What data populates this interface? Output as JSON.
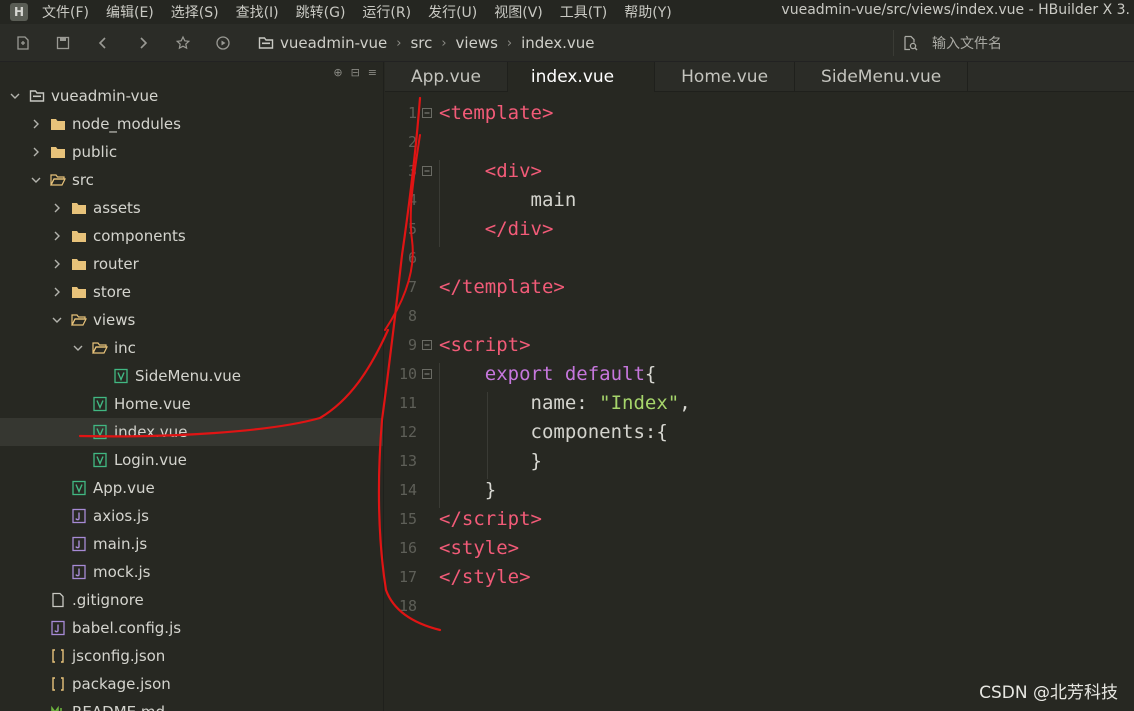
{
  "menu": {
    "items": [
      "文件(F)",
      "编辑(E)",
      "选择(S)",
      "查找(I)",
      "跳转(G)",
      "运行(R)",
      "发行(U)",
      "视图(V)",
      "工具(T)",
      "帮助(Y)"
    ],
    "window_title": "vueadmin-vue/src/views/index.vue - HBuilder X 3.",
    "logo_letter": "H"
  },
  "toolbar": {
    "breadcrumb": [
      "vueadmin-vue",
      "src",
      "views",
      "index.vue"
    ],
    "search_placeholder": "输入文件名"
  },
  "sidebar": {
    "tree": [
      {
        "label": "vueadmin-vue",
        "depth": 0,
        "kind": "project",
        "expanded": true
      },
      {
        "label": "node_modules",
        "depth": 1,
        "kind": "folder",
        "expanded": false
      },
      {
        "label": "public",
        "depth": 1,
        "kind": "folder",
        "expanded": false
      },
      {
        "label": "src",
        "depth": 1,
        "kind": "folder-open",
        "expanded": true
      },
      {
        "label": "assets",
        "depth": 2,
        "kind": "folder",
        "expanded": false
      },
      {
        "label": "components",
        "depth": 2,
        "kind": "folder",
        "expanded": false
      },
      {
        "label": "router",
        "depth": 2,
        "kind": "folder",
        "expanded": false
      },
      {
        "label": "store",
        "depth": 2,
        "kind": "folder",
        "expanded": false
      },
      {
        "label": "views",
        "depth": 2,
        "kind": "folder-open",
        "expanded": true
      },
      {
        "label": "inc",
        "depth": 3,
        "kind": "folder-open",
        "expanded": true
      },
      {
        "label": "SideMenu.vue",
        "depth": 4,
        "kind": "vue"
      },
      {
        "label": "Home.vue",
        "depth": 3,
        "kind": "vue"
      },
      {
        "label": "index.vue",
        "depth": 3,
        "kind": "vue",
        "selected": true
      },
      {
        "label": "Login.vue",
        "depth": 3,
        "kind": "vue"
      },
      {
        "label": "App.vue",
        "depth": 2,
        "kind": "vue"
      },
      {
        "label": "axios.js",
        "depth": 2,
        "kind": "js"
      },
      {
        "label": "main.js",
        "depth": 2,
        "kind": "js"
      },
      {
        "label": "mock.js",
        "depth": 2,
        "kind": "js"
      },
      {
        "label": ".gitignore",
        "depth": 1,
        "kind": "file"
      },
      {
        "label": "babel.config.js",
        "depth": 1,
        "kind": "js"
      },
      {
        "label": "jsconfig.json",
        "depth": 1,
        "kind": "json"
      },
      {
        "label": "package.json",
        "depth": 1,
        "kind": "json"
      },
      {
        "label": "README.md",
        "depth": 1,
        "kind": "md"
      }
    ]
  },
  "editor": {
    "tabs": [
      {
        "label": "App.vue",
        "active": false
      },
      {
        "label": "index.vue",
        "active": true
      },
      {
        "label": "Home.vue",
        "active": false
      },
      {
        "label": "SideMenu.vue",
        "active": false
      }
    ],
    "lines": [
      {
        "n": "1",
        "fold": true,
        "tokens": [
          [
            "tag",
            "<template"
          ],
          [
            "tag",
            ">"
          ]
        ]
      },
      {
        "n": "2",
        "fold": false,
        "tokens": []
      },
      {
        "n": "3",
        "fold": true,
        "tokens": [
          [
            "plain",
            "    "
          ],
          [
            "tag",
            "<div"
          ],
          [
            "tag",
            ">"
          ]
        ]
      },
      {
        "n": "4",
        "fold": false,
        "tokens": [
          [
            "plain",
            "        main"
          ]
        ]
      },
      {
        "n": "5",
        "fold": false,
        "tokens": [
          [
            "plain",
            "    "
          ],
          [
            "tag",
            "</div"
          ],
          [
            "tag",
            ">"
          ]
        ]
      },
      {
        "n": "6",
        "fold": false,
        "tokens": []
      },
      {
        "n": "7",
        "fold": false,
        "tokens": [
          [
            "tag",
            "</template"
          ],
          [
            "tag",
            ">"
          ]
        ]
      },
      {
        "n": "8",
        "fold": false,
        "tokens": []
      },
      {
        "n": "9",
        "fold": true,
        "tokens": [
          [
            "tag",
            "<script"
          ],
          [
            "tag",
            ">"
          ]
        ]
      },
      {
        "n": "10",
        "fold": true,
        "tokens": [
          [
            "plain",
            "    "
          ],
          [
            "kw",
            "export default"
          ],
          [
            "punc",
            "{"
          ]
        ]
      },
      {
        "n": "11",
        "fold": false,
        "tokens": [
          [
            "plain",
            "        name: "
          ],
          [
            "str",
            "\"Index\""
          ],
          [
            "punc",
            ","
          ]
        ]
      },
      {
        "n": "12",
        "fold": false,
        "tokens": [
          [
            "plain",
            "        components:"
          ],
          [
            "punc",
            "{"
          ]
        ]
      },
      {
        "n": "13",
        "fold": false,
        "tokens": [
          [
            "plain",
            "        "
          ],
          [
            "punc",
            "}"
          ]
        ]
      },
      {
        "n": "14",
        "fold": false,
        "tokens": [
          [
            "plain",
            "    "
          ],
          [
            "punc",
            "}"
          ]
        ]
      },
      {
        "n": "15",
        "fold": false,
        "tokens": [
          [
            "tag",
            "</script"
          ],
          [
            "tag",
            ">"
          ]
        ]
      },
      {
        "n": "16",
        "fold": false,
        "tokens": [
          [
            "tag",
            "<style"
          ],
          [
            "tag",
            ">"
          ]
        ]
      },
      {
        "n": "17",
        "fold": false,
        "tokens": [
          [
            "tag",
            "</style"
          ],
          [
            "tag",
            ">"
          ]
        ]
      },
      {
        "n": "18",
        "fold": false,
        "tokens": []
      }
    ]
  },
  "watermark": "CSDN @北芳科技",
  "colors": {
    "background": "#272822",
    "tag": "#f25b78",
    "keyword": "#c677dd",
    "string": "#a6d56b",
    "vue_icon": "#41b883",
    "js_icon": "#a78bd6",
    "folder": "#e7c27a",
    "annotation": "#e01414"
  }
}
